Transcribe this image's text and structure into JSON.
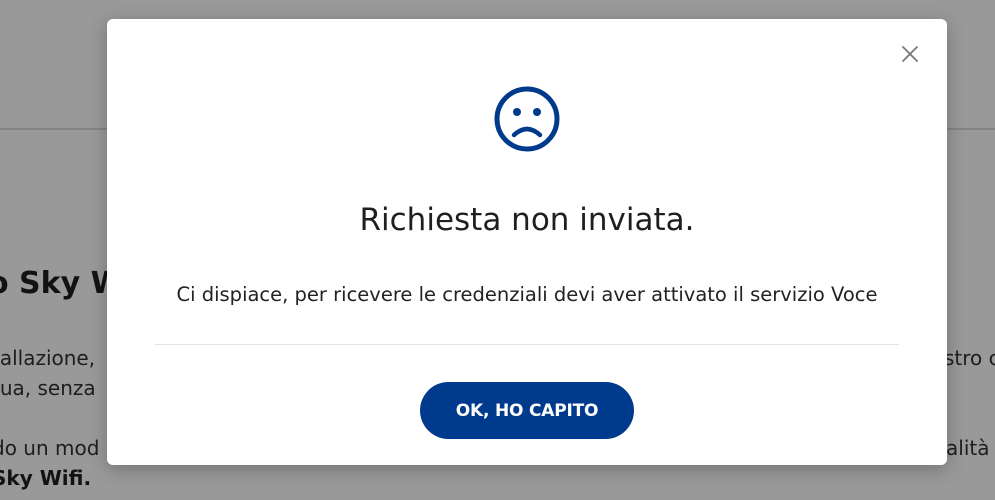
{
  "background": {
    "heading": "o Sky W",
    "lines": [
      "tallazione,",
      "tua, senza",
      "do un mod",
      "Sky Wifi."
    ],
    "right_fragments": [
      "stro c",
      "alità"
    ]
  },
  "modal": {
    "title": "Richiesta non inviata.",
    "message": "Ci dispiace, per ricevere le credenziali devi aver attivato il servizio Voce",
    "ok_button_label": "OK, HO CAPITO",
    "status_icon": "sad-face-icon",
    "close_icon": "close-icon"
  },
  "colors": {
    "accent": "#003a8c",
    "overlay": "rgba(0,0,0,0.40)",
    "close_icon": "#777777"
  }
}
